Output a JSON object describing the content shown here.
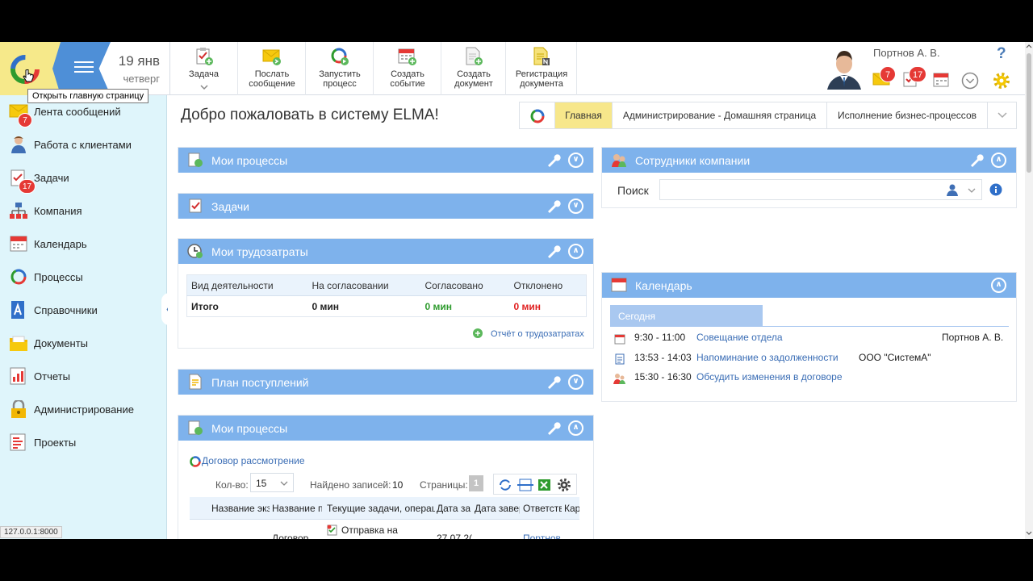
{
  "header": {
    "date_day": "19 янв",
    "date_weekday": "четверг",
    "logo_tooltip": "Открыть главную страницу",
    "toolbar": [
      {
        "label": "Задача",
        "icon": "task-add-icon"
      },
      {
        "label": "Послать сообщение",
        "icon": "message-send-icon"
      },
      {
        "label": "Запустить процесс",
        "icon": "process-start-icon"
      },
      {
        "label": "Создать событие",
        "icon": "event-create-icon"
      },
      {
        "label": "Создать документ",
        "icon": "document-create-icon"
      },
      {
        "label": "Регистрация документа",
        "icon": "document-register-icon"
      }
    ],
    "user_name": "Портнов А. В.",
    "messages_badge": "7",
    "tasks_badge": "17",
    "help_label": "?"
  },
  "sidebar": {
    "items": [
      {
        "label": "Лента сообщений",
        "icon": "message-feed-icon",
        "badge": "7"
      },
      {
        "label": "Работа с клиентами",
        "icon": "clients-icon"
      },
      {
        "label": "Задачи",
        "icon": "tasks-icon",
        "badge": "17"
      },
      {
        "label": "Компания",
        "icon": "company-icon"
      },
      {
        "label": "Календарь",
        "icon": "calendar-icon"
      },
      {
        "label": "Процессы",
        "icon": "processes-icon"
      },
      {
        "label": "Справочники",
        "icon": "directories-icon"
      },
      {
        "label": "Документы",
        "icon": "documents-icon"
      },
      {
        "label": "Отчеты",
        "icon": "reports-icon"
      },
      {
        "label": "Администрирование",
        "icon": "administration-icon"
      },
      {
        "label": "Проекты",
        "icon": "projects-icon"
      }
    ],
    "status_url": "127.0.0.1:8000"
  },
  "main": {
    "title": "Добро пожаловать в систему ELMA!",
    "tabs": [
      "Главная",
      "Администрирование - Домашняя страница",
      "Исполнение бизнес-процессов"
    ],
    "portlets": {
      "my_processes": "Мои процессы",
      "tasks": "Задачи",
      "labor": {
        "title": "Мои трудозатраты",
        "columns": [
          "Вид деятельности",
          "На согласовании",
          "Согласовано",
          "Отклонено"
        ],
        "total_row": [
          "Итого",
          "0 мин",
          "0 мин",
          "0 мин"
        ],
        "report_link": "Отчёт о трудозатратах"
      },
      "income_plan": "План поступлений",
      "my_processes_2": {
        "title": "Мои процессы",
        "process_link": "Договор рассмотрение",
        "count_label": "Кол-во:",
        "count_value": "15",
        "found_label": "Найдено записей:",
        "found_value": "10",
        "pages_label": "Страницы:",
        "pages_value": "1",
        "columns": [
          "Название экз",
          "Название п",
          "Текущие задачи, операц",
          "Дата за",
          "Дата завер",
          "Ответств",
          "Кар"
        ],
        "row": [
          "Договор",
          "Отправка на",
          "27.07.2(",
          "Портнов"
        ]
      },
      "employees": {
        "title": "Сотрудники компании",
        "search_label": "Поиск",
        "search_value": ""
      },
      "calendar": {
        "title": "Календарь",
        "today_label": "Сегодня",
        "events": [
          {
            "time": "9:30 - 11:00",
            "title": "Совещание отдела",
            "extra": "Портнов А. В.",
            "icon": "meeting-icon"
          },
          {
            "time": "13:53 - 14:03",
            "title": "Напоминание о задолженности",
            "extra": "ООО \"СистемА\"",
            "icon": "reminder-icon"
          },
          {
            "time": "15:30 - 16:30",
            "title": "Обсудить изменения в договоре",
            "extra": "",
            "icon": "discussion-icon"
          }
        ]
      }
    }
  },
  "colors": {
    "accent_blue": "#4e8fd7",
    "portlet_header": "#7eb2ec",
    "sidebar_bg": "#dff5fb",
    "active_tab": "#f7e78b",
    "badge_red": "#e53935",
    "approved_green": "#2e9b2e",
    "rejected_red": "#e02020"
  }
}
